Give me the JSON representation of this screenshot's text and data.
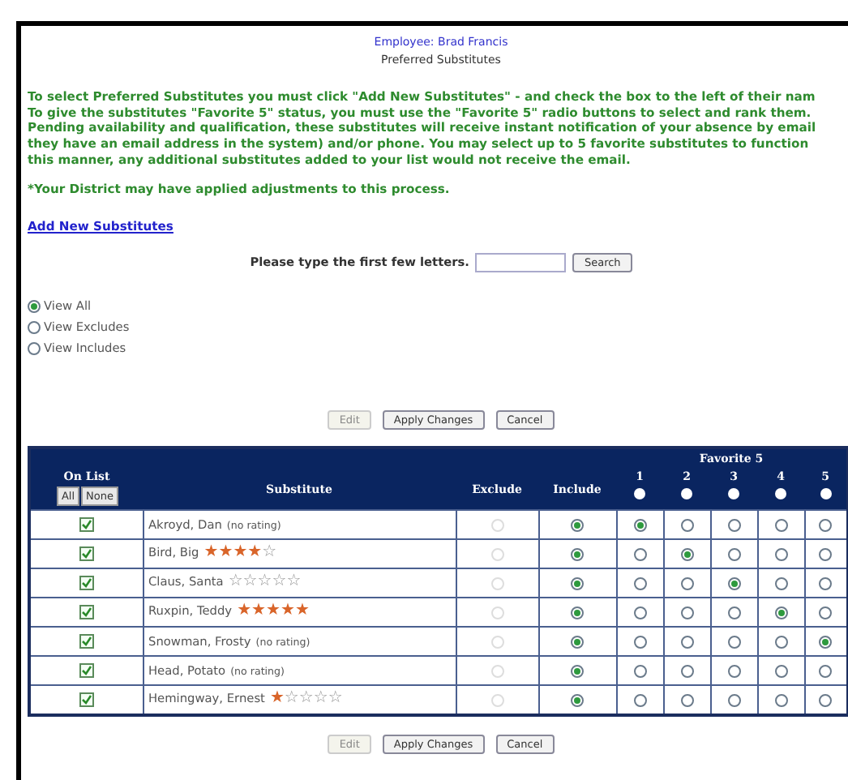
{
  "header": {
    "employee": "Employee: Brad Francis",
    "title": "Preferred Substitutes"
  },
  "instructions": [
    "To select Preferred Substitutes you must click \"Add New Substitutes\" - and check the box to the left of their nam",
    "To give the substitutes \"Favorite 5\" status, you must use the \"Favorite 5\" radio buttons to select and rank them.",
    "Pending availability and qualification, these substitutes will receive instant notification of your absence by email",
    "they have an email address in the system) and/or phone. You may select up to 5 favorite substitutes to function",
    "this manner, any additional substitutes added to your list would not receive the email."
  ],
  "note": "*Your District may have applied adjustments to this process.",
  "add_link": "Add New Substitutes",
  "search": {
    "label": "Please type the first few letters.",
    "button": "Search"
  },
  "views": [
    {
      "label": "View All",
      "selected": true
    },
    {
      "label": "View Excludes",
      "selected": false
    },
    {
      "label": "View Includes",
      "selected": false
    }
  ],
  "actions": [
    {
      "label": "Edit",
      "disabled": true
    },
    {
      "label": "Apply Changes",
      "disabled": false
    },
    {
      "label": "Cancel",
      "disabled": false
    }
  ],
  "table": {
    "on_list": "On List",
    "all": "All",
    "none": "None",
    "substitute": "Substitute",
    "exclude": "Exclude",
    "include": "Include",
    "favorite": "Favorite 5",
    "ranks": [
      "1",
      "2",
      "3",
      "4",
      "5"
    ],
    "rows": [
      {
        "name": "Akroyd, Dan",
        "rating_note": "(no rating)",
        "on_list": true,
        "exclude": false,
        "include": true,
        "favorites": [
          true,
          false,
          false,
          false,
          false
        ]
      },
      {
        "name": "Bird, Big",
        "stars": 4,
        "on_list": true,
        "exclude": false,
        "include": true,
        "favorites": [
          false,
          true,
          false,
          false,
          false
        ]
      },
      {
        "name": "Claus, Santa",
        "stars": 0,
        "on_list": true,
        "exclude": false,
        "include": true,
        "favorites": [
          false,
          false,
          true,
          false,
          false
        ]
      },
      {
        "name": "Ruxpin, Teddy",
        "stars": 5,
        "on_list": true,
        "exclude": false,
        "include": true,
        "favorites": [
          false,
          false,
          false,
          true,
          false
        ]
      },
      {
        "name": "Snowman, Frosty",
        "rating_note": "(no rating)",
        "on_list": true,
        "exclude": false,
        "include": true,
        "favorites": [
          false,
          false,
          false,
          false,
          true
        ]
      },
      {
        "name": "Head, Potato",
        "rating_note": "(no rating)",
        "on_list": true,
        "exclude": false,
        "include": true,
        "favorites": [
          false,
          false,
          false,
          false,
          false
        ]
      },
      {
        "name": "Hemingway, Ernest",
        "stars": 1,
        "on_list": true,
        "exclude": false,
        "include": true,
        "favorites": [
          false,
          false,
          false,
          false,
          false
        ]
      }
    ]
  },
  "bottom_actions": [
    {
      "label": "Edit",
      "disabled": true
    },
    {
      "label": "Apply Changes",
      "disabled": false
    },
    {
      "label": "Cancel",
      "disabled": false
    }
  ]
}
